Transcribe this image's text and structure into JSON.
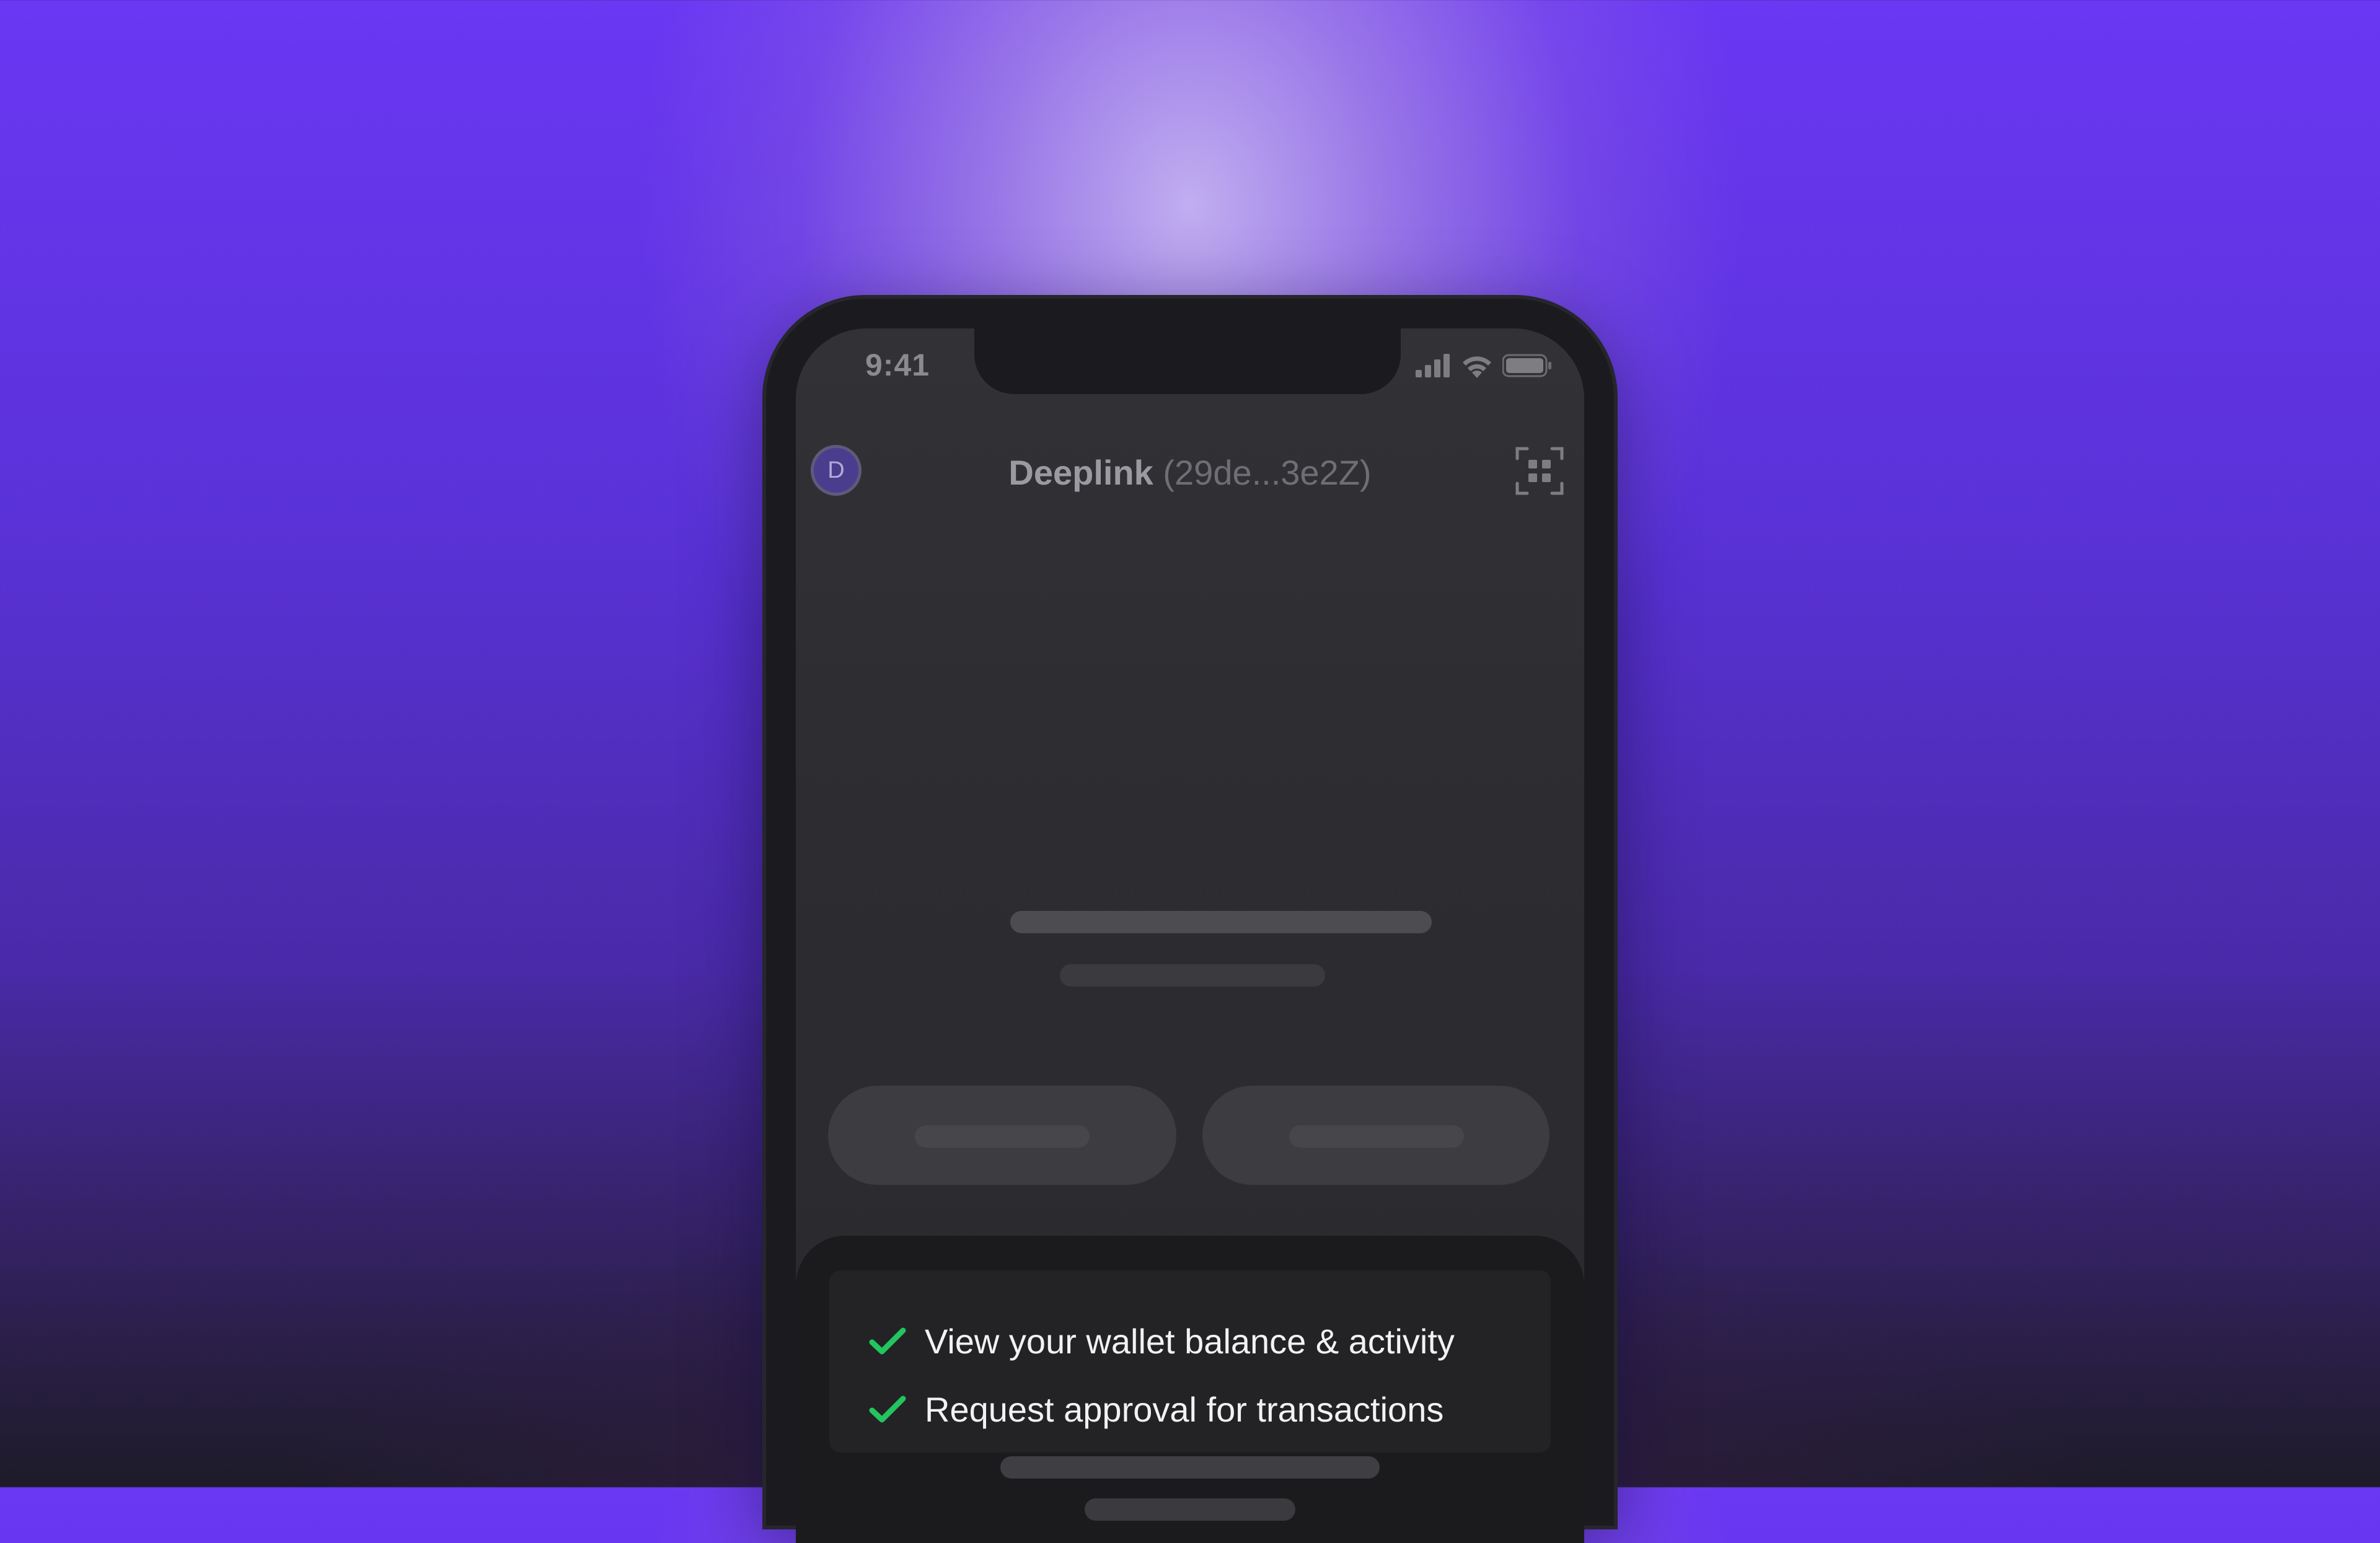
{
  "status_bar": {
    "time": "9:41"
  },
  "header": {
    "avatar_letter": "D",
    "wallet_name": "Deeplink",
    "wallet_address": "(29de...3e2Z)"
  },
  "permissions": [
    {
      "label": "View your wallet balance & activity"
    },
    {
      "label": "Request approval for transactions"
    }
  ],
  "colors": {
    "accent_purple": "#6a37f3",
    "check_green": "#22c55e"
  }
}
